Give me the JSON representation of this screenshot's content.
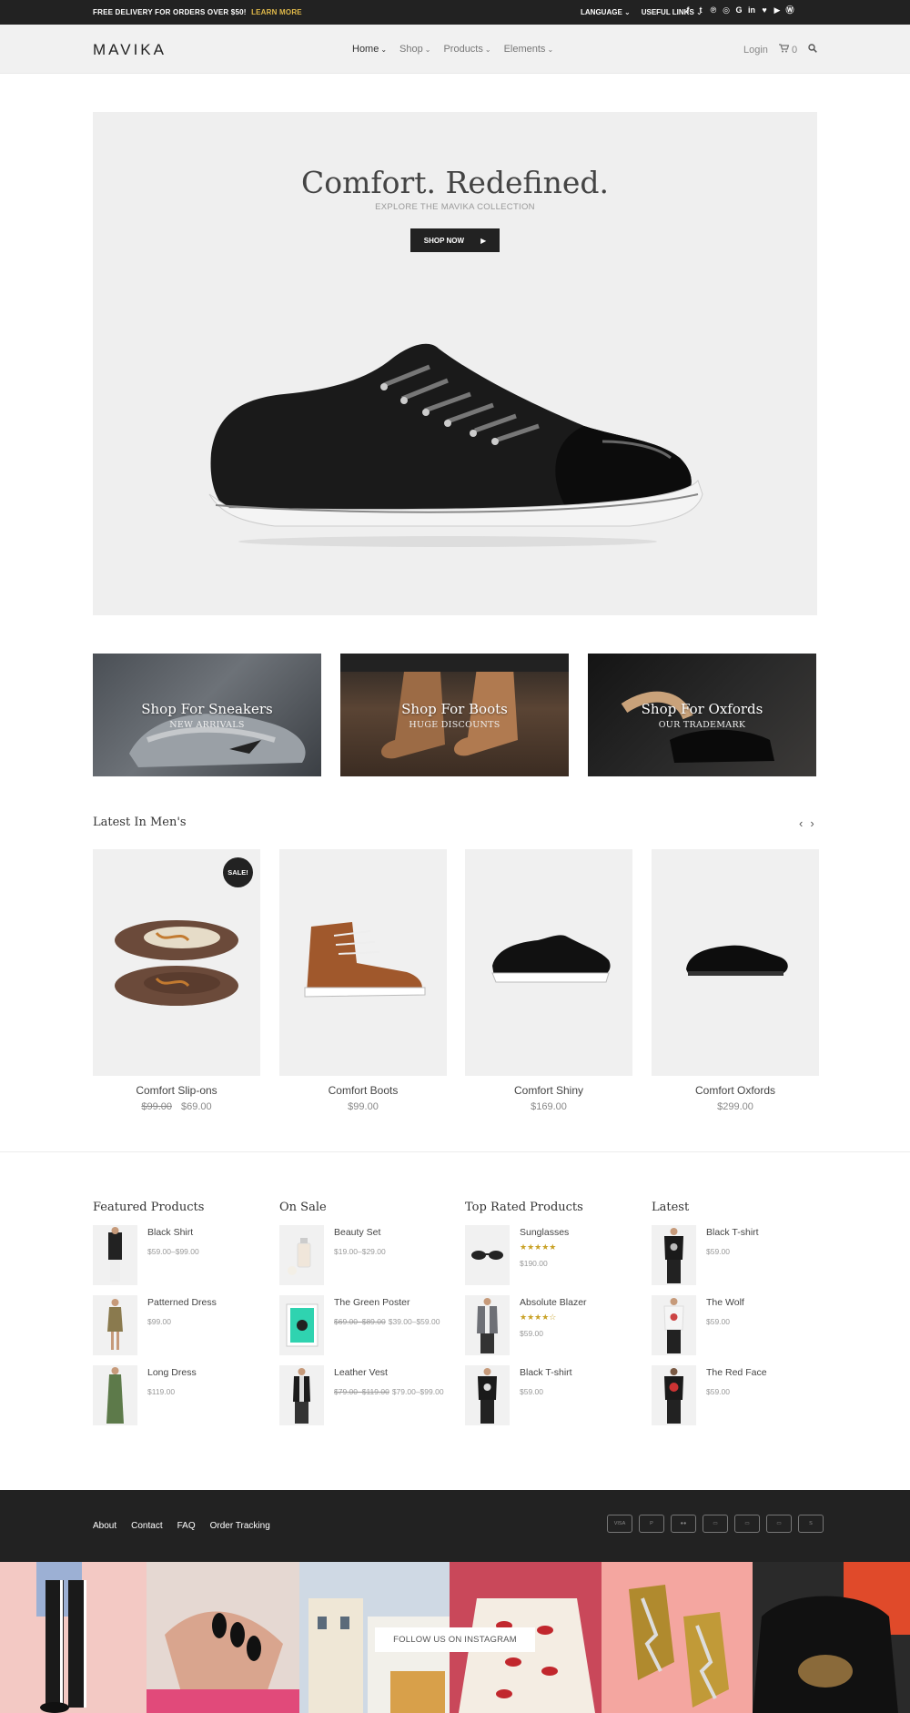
{
  "topbar": {
    "promo_text": "FREE DELIVERY FOR ORDERS OVER $50!",
    "promo_link": "LEARN MORE",
    "language_label": "LANGUAGE",
    "useful_links_label": "USEFUL LINKS",
    "social_icons": [
      "facebook-icon",
      "twitter-icon",
      "pinterest-icon",
      "instagram-icon",
      "google-plus-icon",
      "linkedin-icon",
      "heart-icon",
      "youtube-icon",
      "wordpress-icon"
    ]
  },
  "header": {
    "logo": "MAVIKA",
    "nav": [
      {
        "label": "Home"
      },
      {
        "label": "Shop"
      },
      {
        "label": "Products"
      },
      {
        "label": "Elements"
      }
    ],
    "login_label": "Login",
    "cart_count": "0"
  },
  "hero": {
    "title": "Comfort. Redefined.",
    "subtitle": "EXPLORE THE MAVIKA COLLECTION",
    "button_label": "SHOP NOW"
  },
  "categories": [
    {
      "title": "Shop For Sneakers",
      "subtitle": "NEW ARRIVALS"
    },
    {
      "title": "Shop For Boots",
      "subtitle": "HUGE DISCOUNTS"
    },
    {
      "title": "Shop For Oxfords",
      "subtitle": "OUR TRADEMARK"
    }
  ],
  "latest": {
    "title": "Latest In Men's",
    "sale_badge": "SALE!",
    "products": [
      {
        "name": "Comfort Slip-ons",
        "old_price": "$99.00",
        "price": "$69.00"
      },
      {
        "name": "Comfort Boots",
        "old_price": "",
        "price": "$99.00"
      },
      {
        "name": "Comfort Shiny",
        "old_price": "",
        "price": "$169.00"
      },
      {
        "name": "Comfort Oxfords",
        "old_price": "",
        "price": "$299.00"
      }
    ]
  },
  "widgets": [
    {
      "title": "Featured Products",
      "items": [
        {
          "name": "Black Shirt",
          "price": "$59.00–$99.00"
        },
        {
          "name": "Patterned Dress",
          "price": "$99.00"
        },
        {
          "name": "Long Dress",
          "price": "$119.00"
        }
      ]
    },
    {
      "title": "On Sale",
      "items": [
        {
          "name": "Beauty Set",
          "old": "",
          "price": "$19.00–$29.00"
        },
        {
          "name": "The Green Poster",
          "old": "$69.00–$89.00",
          "price": "$39.00–$59.00"
        },
        {
          "name": "Leather Vest",
          "old": "$79.00–$119.00",
          "price": "$79.00–$99.00"
        }
      ]
    },
    {
      "title": "Top Rated Products",
      "items": [
        {
          "name": "Sunglasses",
          "rating": 5,
          "stars": "★★★★★",
          "price": "$190.00"
        },
        {
          "name": "Absolute Blazer",
          "rating": 4,
          "stars": "★★★★☆",
          "price": "$59.00"
        },
        {
          "name": "Black T-shirt",
          "price": "$59.00"
        }
      ]
    },
    {
      "title": "Latest",
      "items": [
        {
          "name": "Black T-shirt",
          "price": "$59.00"
        },
        {
          "name": "The Wolf",
          "price": "$59.00"
        },
        {
          "name": "The Red Face",
          "price": "$59.00"
        }
      ]
    }
  ],
  "footer": {
    "links": [
      "About",
      "Contact",
      "FAQ",
      "Order Tracking"
    ],
    "payment_icons": [
      "VISA",
      "PayPal",
      "MasterCard",
      "Discover",
      "Amex",
      "Maestro",
      "Stripe"
    ]
  },
  "instagram": {
    "follow_label": "FOLLOW US ON INSTAGRAM"
  },
  "colors": {
    "dark": "#222222",
    "accent": "#e0b94a",
    "star": "#c9a227",
    "panel": "#efefef"
  }
}
